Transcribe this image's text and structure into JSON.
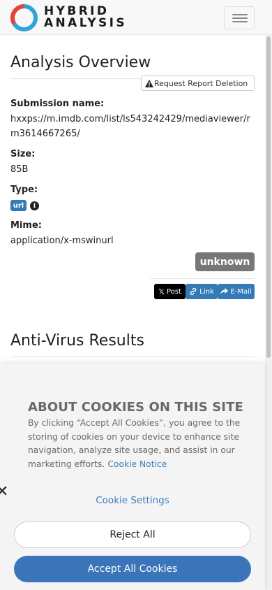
{
  "navbar": {
    "brand_line1": "HYBRID",
    "brand_line2": "ANALYSIS"
  },
  "overview": {
    "title": "Analysis Overview",
    "delete_button": "Request Report Deletion",
    "submission_label": "Submission name:",
    "submission_value_line1": "hxxps://m.imdb.com/list/ls543242429/mediaviewer/r",
    "submission_value_line2": "m3614667265/",
    "size_label": "Size:",
    "size_value": "85B",
    "type_label": "Type:",
    "type_badge": "url",
    "mime_label": "Mime:",
    "mime_value": "application/x-mswinurl",
    "verdict": "unknown",
    "share": {
      "post": "Post",
      "link": "Link",
      "email": "E-Mail"
    }
  },
  "antivirus": {
    "title": "Anti-Virus Results"
  },
  "cookie_banner": {
    "title": "ABOUT COOKIES ON THIS SITE",
    "body": "By clicking “Accept All Cookies”, you agree to the storing of cookies on your device to enhance site navigation, analyze site usage, and assist in our marketing efforts.",
    "notice_link": "Cookie Notice",
    "settings": "Cookie Settings",
    "reject": "Reject All",
    "accept": "Accept All Cookies"
  },
  "colors": {
    "brand_blue": "#2fa4d8",
    "brand_red": "#e8413b",
    "accent": "#337ab7",
    "verdict_grey": "#777777",
    "x_black": "#000000"
  }
}
